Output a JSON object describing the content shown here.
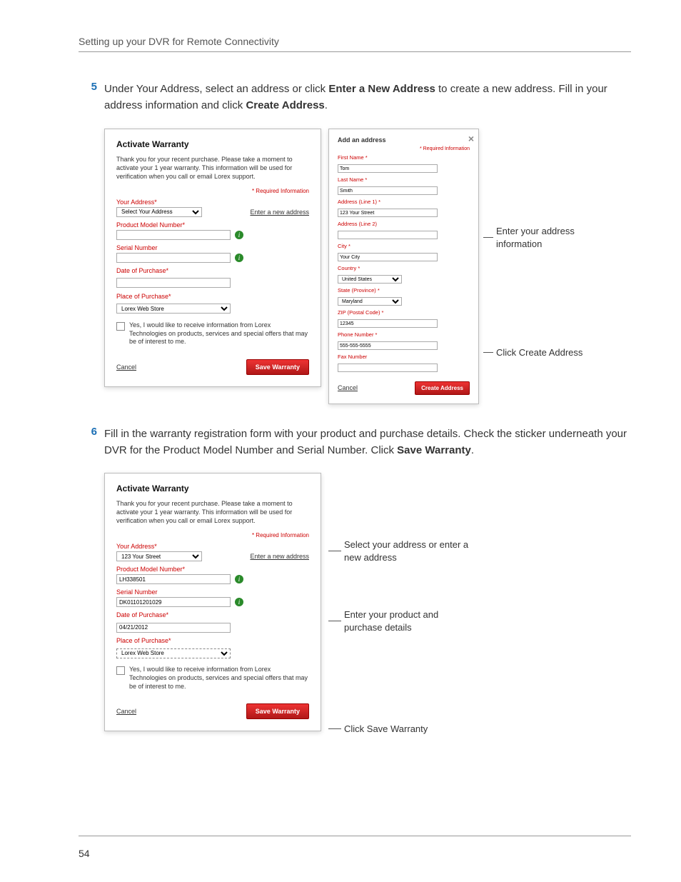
{
  "header": {
    "section_title": "Setting up your DVR for Remote Connectivity"
  },
  "steps": {
    "s5": {
      "num": "5",
      "text_a": "Under Your Address, select an address or click ",
      "bold_a": "Enter a New Address",
      "text_b": " to create a new address. Fill in your address information and click ",
      "bold_b": "Create Address",
      "text_c": "."
    },
    "s6": {
      "num": "6",
      "text_a": "Fill in the warranty registration form with your product and purchase details. Check the sticker underneath your DVR for the Product Model Number and Serial Number. Click ",
      "bold_a": "Save Warranty",
      "text_b": "."
    }
  },
  "warranty": {
    "title": "Activate Warranty",
    "intro": "Thank you for your recent purchase. Please take a moment to activate your 1 year warranty. This information will be used for verification when you call or email Lorex support.",
    "required": "* Required Information",
    "your_address": "Your Address*",
    "address_sel": "Select Your Address",
    "address_sel2": "123 Your Street",
    "enter_new": "Enter a new address",
    "model": "Product Model Number*",
    "model_val": "LH338501",
    "serial": "Serial Number",
    "serial_val": "DK01101201029",
    "date": "Date of Purchase*",
    "date_val": "04/21/2012",
    "place": "Place of Purchase*",
    "place_val": "Lorex Web Store",
    "optin": "Yes, I would like to receive information from Lorex Technologies on products, services and special offers that may be of interest to me.",
    "save": "Save Warranty",
    "cancel": "Cancel"
  },
  "address_form": {
    "title": "Add an address",
    "required": "* Required Information",
    "first": "First Name *",
    "first_v": "Tom",
    "last": "Last Name *",
    "last_v": "Smith",
    "line1": "Address (Line 1) *",
    "line1_v": "123 Your Street",
    "line2": "Address (Line 2)",
    "city": "City *",
    "city_v": "Your City",
    "country": "Country *",
    "country_v": "United States",
    "state": "State (Province) *",
    "state_v": "Maryland",
    "zip": "ZIP (Postal Code) *",
    "zip_v": "12345",
    "phone": "Phone Number *",
    "phone_v": "555-555-5555",
    "fax": "Fax Number",
    "cancel": "Cancel",
    "create": "Create Address"
  },
  "annotations": {
    "enter_info": "Enter your address information",
    "click_create": "Click Create Address",
    "select_addr": "Select your address or enter a new address",
    "enter_prod": "Enter your product and purchase details",
    "click_save": "Click Save Warranty"
  },
  "page_number": "54"
}
